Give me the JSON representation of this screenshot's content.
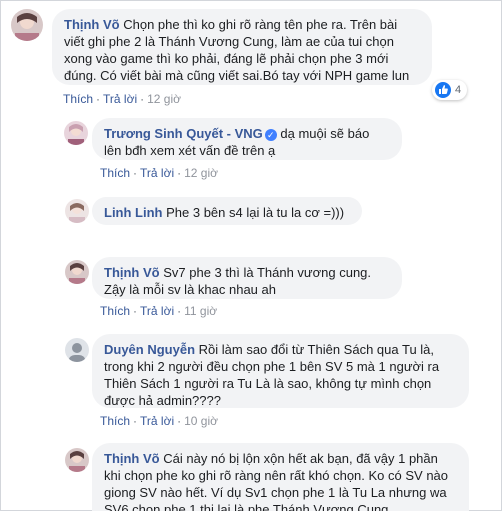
{
  "labels": {
    "like": "Thích",
    "reply": "Trả lời",
    "dot": "·"
  },
  "comments": [
    {
      "author": "Thịnh Võ",
      "text": "Chọn phe thì ko ghi rõ ràng tên phe ra. Trên bài viết ghi phe 2 là Thánh Vương Cung, làm ae của tui chọn xong vào game thì ko phải, đáng lẽ phải chọn phe 3 mới đúng. Có viết bài mà cũng viết sai.Bó tay với NPH game lun",
      "time": "12 giờ",
      "reaction_count": "4"
    },
    {
      "author": "Trương Sinh Quyết - VNG",
      "text": "dạ muội sẽ báo lên bđh xem xét vấn đề trên ạ",
      "time": "12 giờ"
    },
    {
      "author": "Linh Linh",
      "text": "Phe 3 bên s4 lại là tu la cơ =)))"
    },
    {
      "author": "Thịnh Võ",
      "text": "Sv7 phe 3 thì là Thánh vương cung. Zậy là mỗi sv là khac nhau ah",
      "time": "11 giờ"
    },
    {
      "author": "Duyên Nguyễn",
      "text": "Rồi làm sao đổi từ Thiên Sách qua Tu là, trong khi 2 người đều chọn phe 1 bên SV 5 mà 1 người ra Thiên Sách 1 người ra Tu Là là sao, không tự mình chọn được hả admin????",
      "time": "10 giờ"
    },
    {
      "author": "Thịnh Võ",
      "text": "Cái này nó bị lộn xộn hết ak bạn, đã vậy 1 phần khi chọn phe ko ghi rõ ràng nên rất khó chọn. Ko có SV nào giong SV nào hết. Ví dụ Sv1 chọn phe 1 là Tu La nhưng wa SV6 chọn phe 1 thị lại là phe Thánh Vương Cung"
    }
  ],
  "colors": {
    "link": "#385898",
    "bubble": "#f2f3f5",
    "meta": "#606770",
    "like": "#1877f2"
  }
}
